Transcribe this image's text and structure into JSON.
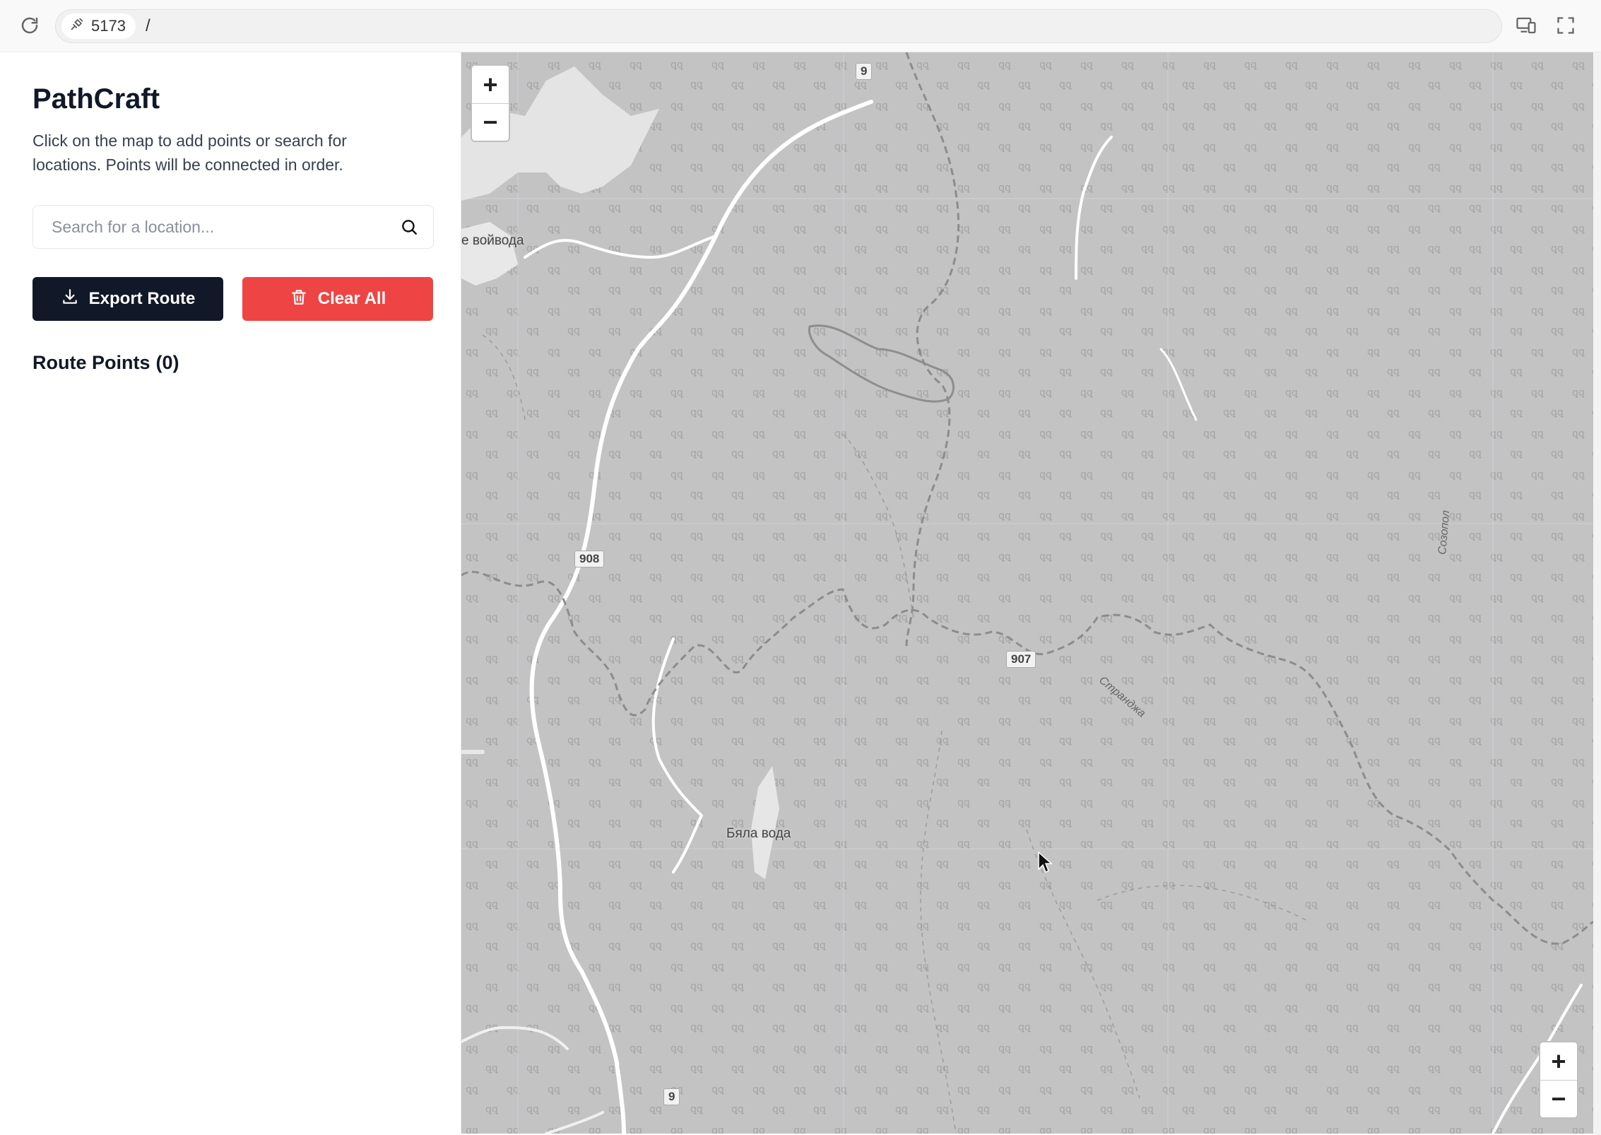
{
  "browser": {
    "port": "5173",
    "path": "/"
  },
  "sidebar": {
    "title": "PathCraft",
    "description": "Click on the map to add points or search for locations. Points will be connected in order.",
    "search_placeholder": "Search for a location...",
    "export_label": "Export Route",
    "clear_label": "Clear All",
    "route_points_label": "Route Points",
    "route_points_count": "(0)"
  },
  "map": {
    "zoom_in": "+",
    "zoom_out": "−",
    "roads": {
      "r9_top": "9",
      "r908": "908",
      "r907": "907",
      "r9_bottom": "9"
    },
    "places": {
      "village_left": "е войвода",
      "village_center": "Бяла вода"
    },
    "rivers": {
      "sozopol": "Созопол",
      "strandzha": "Странджа"
    }
  },
  "colors": {
    "map_bg": "#c3c3c3",
    "export_bg": "#111827",
    "clear_bg": "#ef4444"
  }
}
